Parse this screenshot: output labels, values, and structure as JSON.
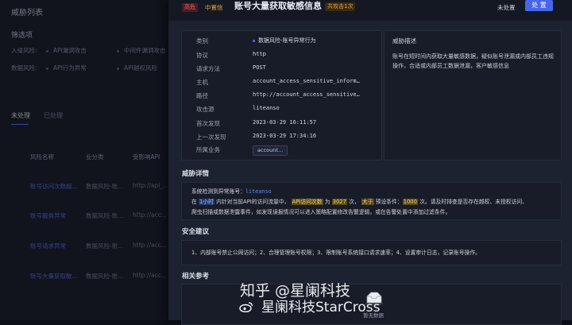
{
  "background": {
    "title": "威胁列表",
    "filter_title": "筛选项",
    "filters": [
      {
        "label": "入侵风险:",
        "options": [
          "API漏洞攻击",
          "中间件漏洞攻击"
        ]
      },
      {
        "label": "数据风险:",
        "options": [
          "API行为异常",
          "API越权风险"
        ]
      }
    ],
    "tabs": [
      "未处理",
      "已处理"
    ],
    "table_headers": [
      "风险名称",
      "业分类",
      "受影响API"
    ],
    "rows": [
      {
        "name": "账号访问次数超...",
        "category": "数据风险-账...",
        "api": "http://api_..."
      },
      {
        "name": "账号服务异常",
        "category": "数据风险-账...",
        "api": "http://acc..."
      },
      {
        "name": "账号请求异常",
        "category": "数据风险-账...",
        "api": "http://acc..."
      },
      {
        "name": "账号大量获取敏...",
        "category": "数据风险-账...",
        "api": "http://acc..."
      }
    ]
  },
  "drawer": {
    "severity": "高危",
    "confidence": "中置信",
    "title": "账号大量获取敏感信息",
    "attack_count": "共攻击1次",
    "status": "未处置",
    "action_button": "处 置",
    "info": [
      {
        "label": "类别",
        "value": "数据风险-账号异常行为"
      },
      {
        "label": "协议",
        "value": "http"
      },
      {
        "label": "请求方法",
        "value": "POST"
      },
      {
        "label": "主机",
        "value": "account_access_sensitive_inform…"
      },
      {
        "label": "路径",
        "value": "http://account_access_sensitive…"
      },
      {
        "label": "攻击源",
        "value": "liteanso"
      },
      {
        "label": "首次发现",
        "value": "2023-03-29 16:11:57"
      },
      {
        "label": "上一次发现",
        "value": "2023-03-29 17:34:16"
      },
      {
        "label": "所属业务",
        "value": "account…"
      }
    ],
    "description": {
      "title": "威胁描述",
      "text": "账号在短时间内获取大量敏感数据，疑似账号泄漏或内部员工违规操作，合适或内部员工数据泄漏，客户敏感信息"
    },
    "threat_detail": {
      "title": "威胁详情",
      "line1_prefix": "系统检测到异常账号：",
      "account": "liteanso",
      "line2_a": "在",
      "period": "1小时",
      "line2_b": "内针对当前API的访问流量中，",
      "metric": "API访问次数",
      "line2_c": "为",
      "count": "3027",
      "line2_d": "次，",
      "comparator": "大于",
      "line2_e": "预设条件：",
      "threshold": "1000",
      "line2_f": "次。请及时排查是否存在越权、未授权访问、",
      "line3": "爬虫扫描或数据泄露事件，如发现误报情况可以进入策略配置修改告警逻辑，或在告警处置中添加过滤条件。"
    },
    "advice": {
      "title": "安全建议",
      "text": "1、内部账号禁止公网访问；2、合理管理账号权限；3、限制账号系统接口请求速率；4、设置审计日志，记录账号操作。"
    },
    "references": {
      "title": "相关参考",
      "empty_text": "暂无数据"
    }
  },
  "watermark": {
    "line1": "知乎 @星阑科技",
    "line2": "星阑科技StarCross"
  }
}
